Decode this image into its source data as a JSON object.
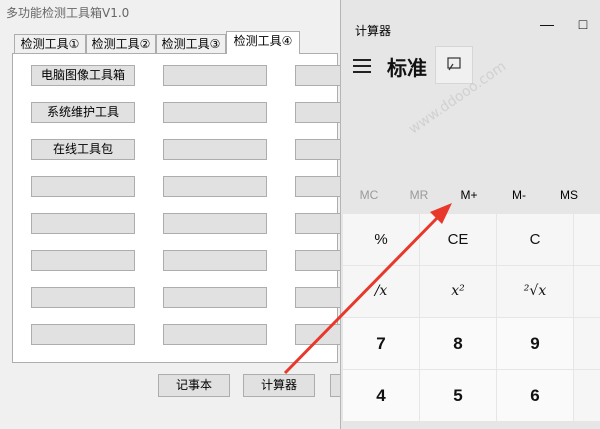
{
  "tool_window": {
    "title": "多功能检测工具箱V1.0",
    "tabs": [
      "检测工具①",
      "检测工具②",
      "检测工具③",
      "检测工具④"
    ],
    "col1_buttons": [
      "电脑图像工具箱",
      "系统维护工具",
      "在线工具包",
      "",
      "",
      "",
      "",
      ""
    ],
    "bottom_buttons": [
      "记事本",
      "计算器"
    ]
  },
  "calculator": {
    "window_title": "计算器",
    "mode_title": "标准",
    "memory": [
      "MC",
      "MR",
      "M+",
      "M-",
      "MS"
    ],
    "keys_row1": [
      "%",
      "CE",
      "C"
    ],
    "keys_row2": [
      "/x",
      "x²",
      "²√x"
    ],
    "keys_row3": [
      "7",
      "8",
      "9"
    ],
    "keys_row4": [
      "4",
      "5",
      "6"
    ]
  },
  "watermark": "www.ddooo.com"
}
